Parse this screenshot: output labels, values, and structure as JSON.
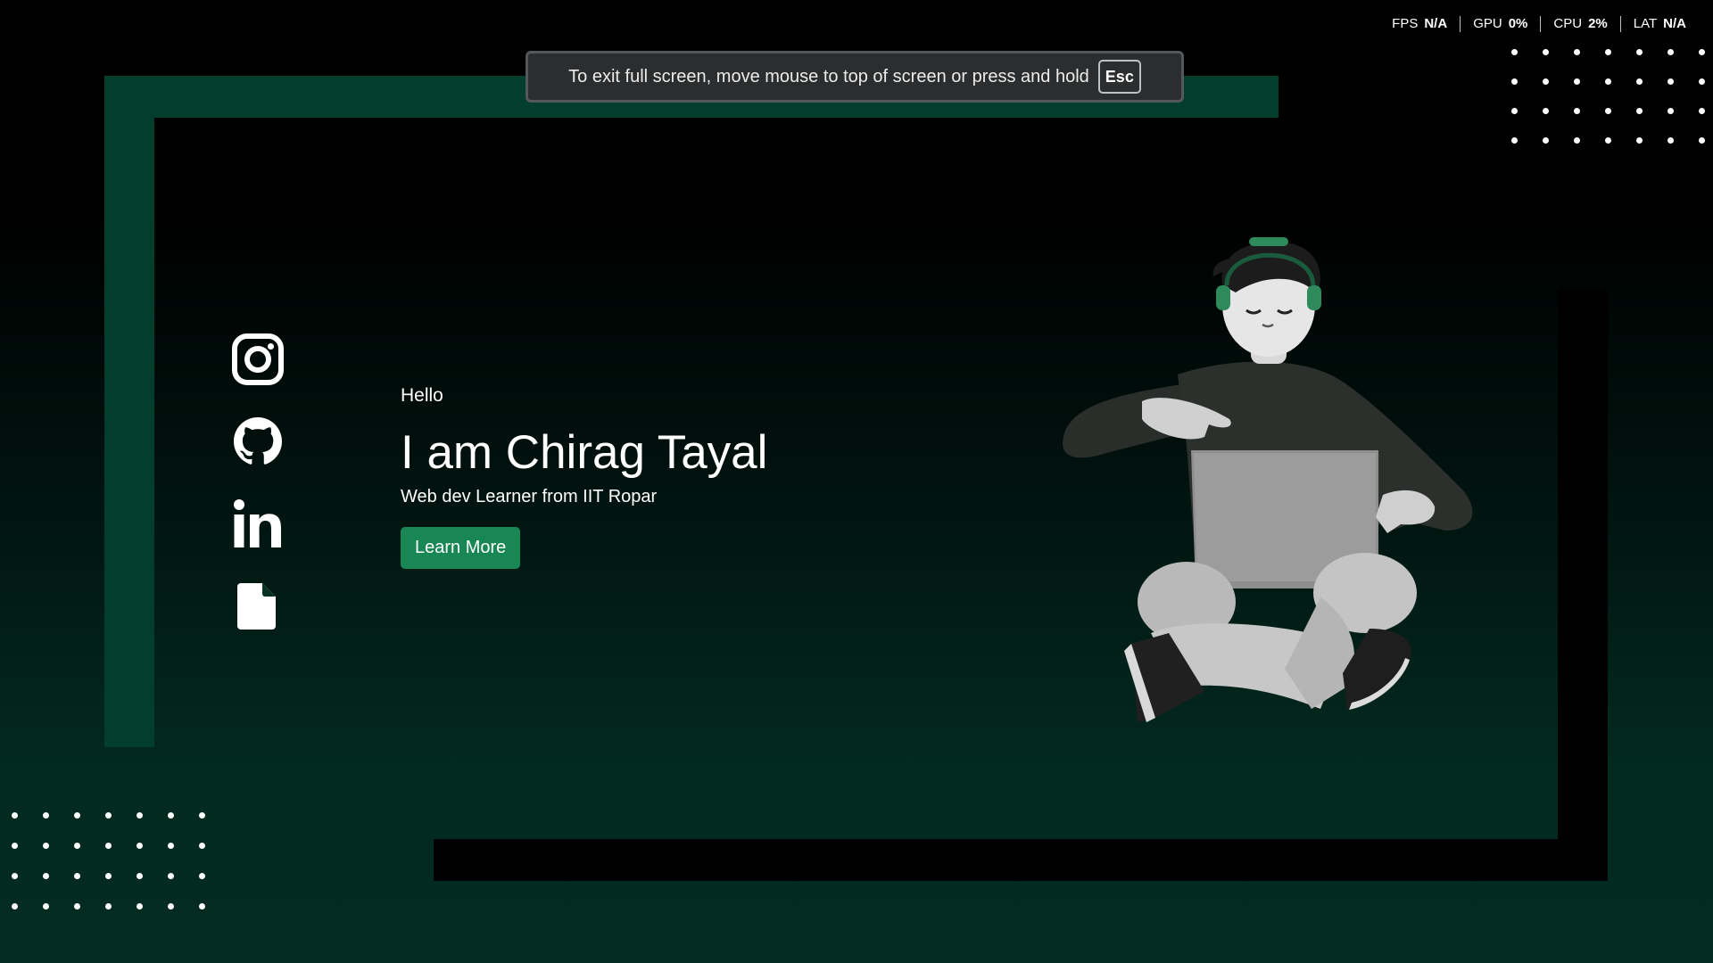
{
  "fullscreen_notice": {
    "message": "To exit full screen, move mouse to top of screen or press and hold",
    "key": "Esc"
  },
  "perf_overlay": [
    {
      "label": "FPS",
      "value": "N/A"
    },
    {
      "label": "GPU",
      "value": "0%"
    },
    {
      "label": "CPU",
      "value": "2%"
    },
    {
      "label": "LAT",
      "value": "N/A"
    }
  ],
  "socials": [
    {
      "name": "Instagram",
      "icon": "instagram-icon"
    },
    {
      "name": "GitHub",
      "icon": "github-icon"
    },
    {
      "name": "LinkedIn",
      "icon": "linkedin-icon"
    },
    {
      "name": "Resume",
      "icon": "file-icon"
    }
  ],
  "hero": {
    "greeting": "Hello",
    "title": "I am Chirag Tayal",
    "subtitle": "Web dev Learner from IIT Ropar",
    "cta_label": "Learn More"
  },
  "colors": {
    "accent": "#198754",
    "frame_green": "#033d2b",
    "background_dark": "#000000",
    "background_green": "#032b20"
  }
}
